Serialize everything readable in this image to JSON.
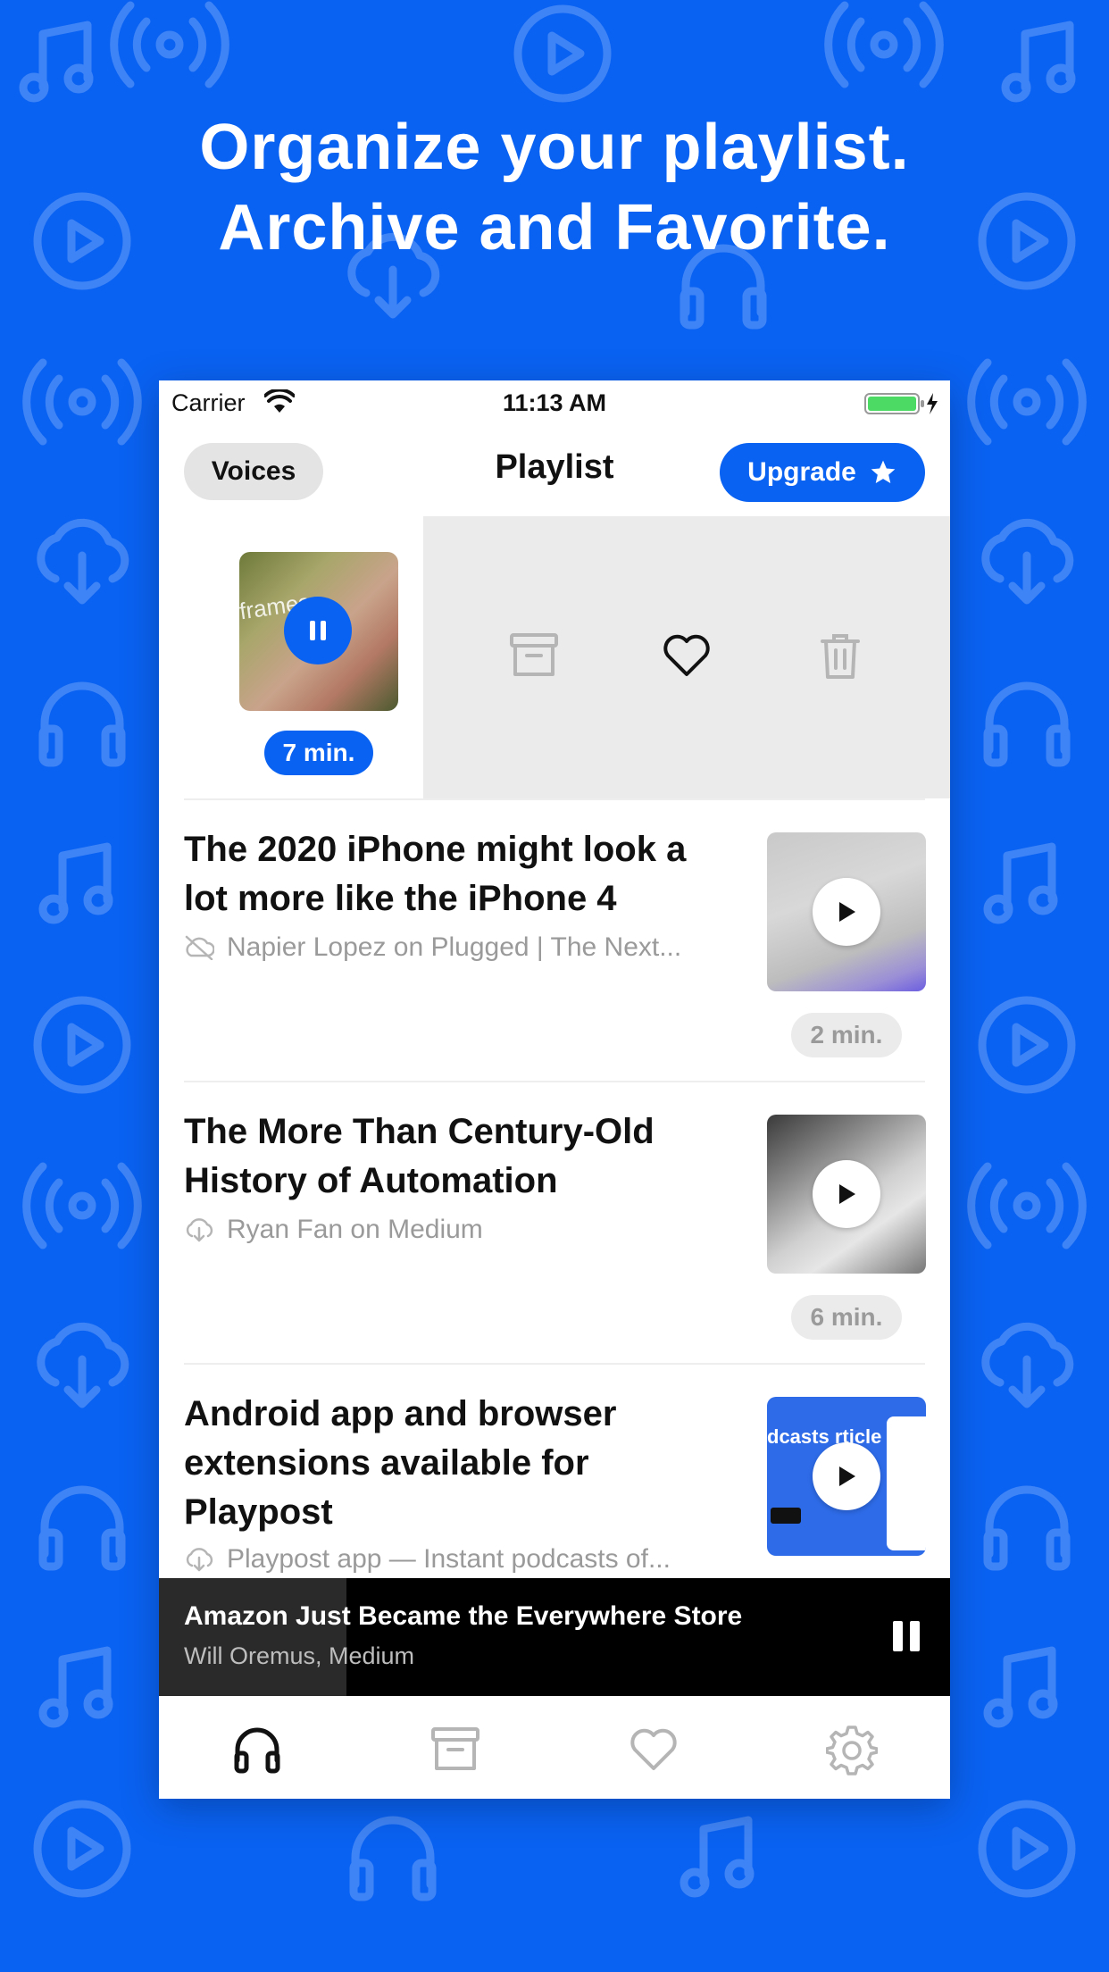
{
  "headline": {
    "line1": "Organize your playlist.",
    "line2": "Archive and Favorite."
  },
  "status_bar": {
    "carrier": "Carrier",
    "time": "11:13 AM"
  },
  "nav": {
    "voices_label": "Voices",
    "title": "Playlist",
    "upgrade_label": "Upgrade"
  },
  "swiped_item": {
    "thumb_text": "frames",
    "duration": "7 min."
  },
  "items": [
    {
      "title": "The 2020 iPhone might look a lot more like the iPhone 4",
      "source": "Napier Lopez on Plugged | The Next...",
      "duration": "2 min."
    },
    {
      "title": "The More Than Century-Old History of Automation",
      "source": "Ryan Fan on Medium",
      "duration": "6 min."
    },
    {
      "title": "Android app and browser extensions available for Playpost",
      "source": "Playpost app — Instant podcasts of...",
      "thumb_text": "dcasts rticle"
    }
  ],
  "now_playing": {
    "title": "Amazon Just Became the Everywhere Store",
    "subtitle": "Will Oremus, Medium"
  },
  "colors": {
    "brand_blue": "#0A62F2",
    "background": "#0A62F2",
    "player_bar": "#000000",
    "battery_green": "#4CD964"
  },
  "icons": {
    "tabs": [
      "headphones-icon",
      "archive-icon",
      "heart-icon",
      "gear-icon"
    ],
    "swipe_actions": [
      "archive-icon",
      "heart-icon",
      "trash-icon"
    ]
  }
}
